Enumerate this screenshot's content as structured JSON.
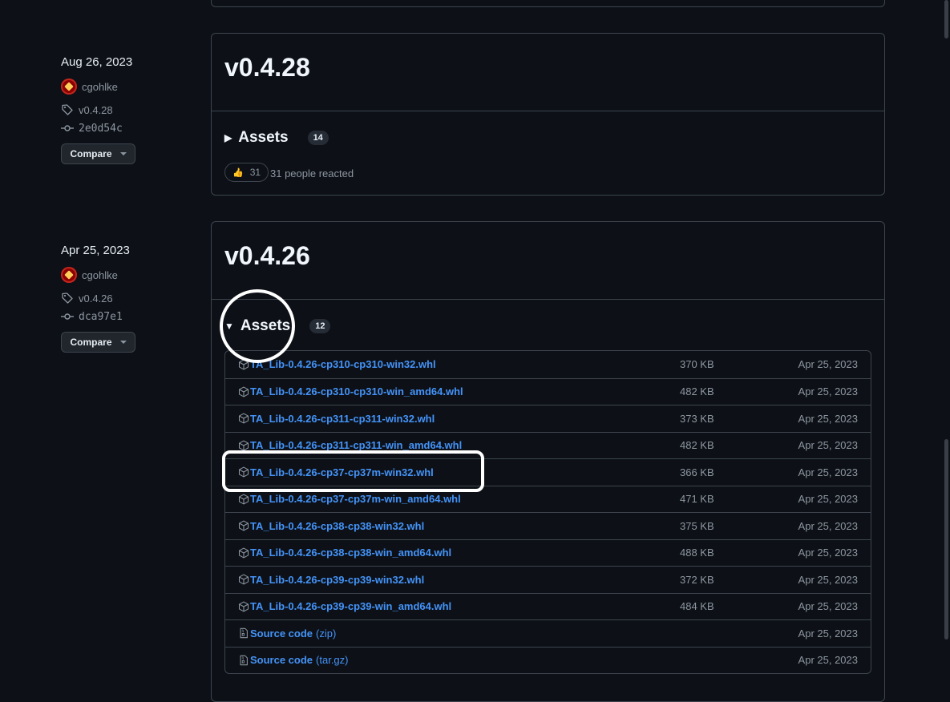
{
  "releases": [
    {
      "date": "Aug 26, 2023",
      "author": "cgohlke",
      "tag": "v0.4.28",
      "commit": "2e0d54c",
      "compare_label": "Compare",
      "title": "v0.4.28",
      "assets_label": "Assets",
      "assets_count": "14",
      "reaction_emoji": "👍",
      "reaction_count": "31",
      "reaction_text": "31 people reacted"
    },
    {
      "date": "Apr 25, 2023",
      "author": "cgohlke",
      "tag": "v0.4.26",
      "commit": "dca97e1",
      "compare_label": "Compare",
      "title": "v0.4.26",
      "assets_label": "Assets",
      "assets_count": "12",
      "assets": [
        {
          "name": "TA_Lib-0.4.26-cp310-cp310-win32.whl",
          "size": "370 KB",
          "date": "Apr 25, 2023",
          "icon": "package-icon"
        },
        {
          "name": "TA_Lib-0.4.26-cp310-cp310-win_amd64.whl",
          "size": "482 KB",
          "date": "Apr 25, 2023",
          "icon": "package-icon"
        },
        {
          "name": "TA_Lib-0.4.26-cp311-cp311-win32.whl",
          "size": "373 KB",
          "date": "Apr 25, 2023",
          "icon": "package-icon"
        },
        {
          "name": "TA_Lib-0.4.26-cp311-cp311-win_amd64.whl",
          "size": "482 KB",
          "date": "Apr 25, 2023",
          "icon": "package-icon"
        },
        {
          "name": "TA_Lib-0.4.26-cp37-cp37m-win32.whl",
          "size": "366 KB",
          "date": "Apr 25, 2023",
          "icon": "package-icon"
        },
        {
          "name": "TA_Lib-0.4.26-cp37-cp37m-win_amd64.whl",
          "size": "471 KB",
          "date": "Apr 25, 2023",
          "icon": "package-icon"
        },
        {
          "name": "TA_Lib-0.4.26-cp38-cp38-win32.whl",
          "size": "375 KB",
          "date": "Apr 25, 2023",
          "icon": "package-icon"
        },
        {
          "name": "TA_Lib-0.4.26-cp38-cp38-win_amd64.whl",
          "size": "488 KB",
          "date": "Apr 25, 2023",
          "icon": "package-icon"
        },
        {
          "name": "TA_Lib-0.4.26-cp39-cp39-win32.whl",
          "size": "372 KB",
          "date": "Apr 25, 2023",
          "icon": "package-icon"
        },
        {
          "name": "TA_Lib-0.4.26-cp39-cp39-win_amd64.whl",
          "size": "484 KB",
          "date": "Apr 25, 2023",
          "icon": "package-icon"
        },
        {
          "name": "Source code",
          "suffix": "(zip)",
          "size": "",
          "date": "Apr 25, 2023",
          "icon": "file-zip-icon"
        },
        {
          "name": "Source code",
          "suffix": "(tar.gz)",
          "size": "",
          "date": "Apr 25, 2023",
          "icon": "file-zip-icon"
        }
      ]
    }
  ],
  "colors": {
    "background": "#0d1117",
    "border": "#3d444d",
    "link": "#4493f8",
    "muted": "#8d96a0",
    "annotation": "#ffffff"
  }
}
